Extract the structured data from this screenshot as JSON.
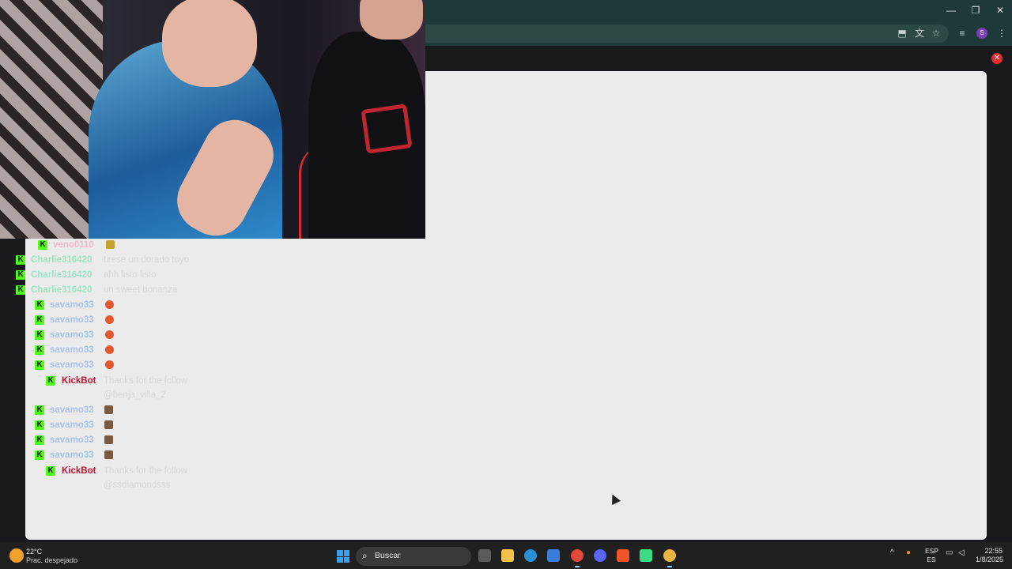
{
  "chat": {
    "messages": [
      {
        "user": "veno0110",
        "text": "",
        "emote": "fries-emote"
      },
      {
        "user": "Charlie316420",
        "text": "tirese un dorado toyo"
      },
      {
        "user": "Charlie316420",
        "text": "ahh listo listo"
      },
      {
        "user": "Charlie316420",
        "text": "un sweet bonanza"
      },
      {
        "user": "savamo33",
        "text": "",
        "emote": "burger-emote"
      },
      {
        "user": "savamo33",
        "text": "",
        "emote": "burger-emote"
      },
      {
        "user": "savamo33",
        "text": "",
        "emote": "burger-emote"
      },
      {
        "user": "savamo33",
        "text": "",
        "emote": "burger-emote"
      },
      {
        "user": "savamo33",
        "text": "",
        "emote": "burger-emote"
      },
      {
        "user": "KickBot",
        "text": "Thanks for the follow",
        "text2": "@benja_villa_2"
      },
      {
        "user": "savamo33",
        "text": "",
        "emote": "box-emote"
      },
      {
        "user": "savamo33",
        "text": "",
        "emote": "box-emote"
      },
      {
        "user": "savamo33",
        "text": "",
        "emote": "box-emote"
      },
      {
        "user": "savamo33",
        "text": "",
        "emote": "box-emote"
      },
      {
        "user": "KickBot",
        "text": "Thanks for the follow",
        "text2": "@ssdiamondsss"
      }
    ]
  },
  "taskbar": {
    "temperature": "22°C",
    "weather": "Prac. despejado",
    "search_placeholder": "Buscar",
    "lang_top": "ESP",
    "lang_bottom": "ES",
    "time": "22:55",
    "date": "1/8/2025"
  },
  "icons": {
    "badge": "K",
    "close": "✕",
    "profile": "S",
    "search": "⌕",
    "minimize": "—",
    "restore": "❐",
    "win_close": "✕",
    "caret": "^",
    "mic": "🎙",
    "wifi": "▭",
    "volume": "🔊"
  },
  "colors": {
    "chrome": "#1e3a38",
    "panel": "#ebebeb",
    "kick_green": "#53fc18",
    "close_red": "#e02d2d",
    "taskbar": "#202020"
  }
}
